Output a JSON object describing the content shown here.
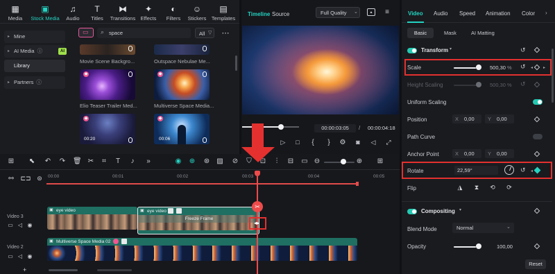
{
  "media_tabs": [
    {
      "label": "Media",
      "icon": "media-icon"
    },
    {
      "label": "Stock Media",
      "icon": "stock-media-icon"
    },
    {
      "label": "Audio",
      "icon": "audio-icon"
    },
    {
      "label": "Titles",
      "icon": "titles-icon"
    },
    {
      "label": "Transitions",
      "icon": "transitions-icon"
    },
    {
      "label": "Effects",
      "icon": "effects-icon"
    },
    {
      "label": "Filters",
      "icon": "filters-icon"
    },
    {
      "label": "Stickers",
      "icon": "stickers-icon"
    },
    {
      "label": "Templates",
      "icon": "templates-icon"
    }
  ],
  "sidebar": {
    "items": [
      {
        "label": "Mine"
      },
      {
        "label": "AI Media",
        "badge": "AI"
      },
      {
        "label": "Library"
      },
      {
        "label": "Partners"
      }
    ]
  },
  "search": {
    "value": "space",
    "filter": "All"
  },
  "thumbs": [
    {
      "label": "Movie Scene Backgro..."
    },
    {
      "label": "Outspace Nebulae Me..."
    },
    {
      "label": "Elio Teaser Trailer Med..."
    },
    {
      "label": "Multiverse Space Media..."
    },
    {
      "label": "",
      "duration": "00:20"
    },
    {
      "label": "",
      "duration": "00:06"
    }
  ],
  "player": {
    "tab_timeline": "Timeline",
    "tab_source": "Source",
    "quality": "Full Quality",
    "current_time": "00:00:03:05",
    "separator": "/",
    "total_time": "00:00:04:18",
    "progress": 0.65
  },
  "timeline": {
    "ruler": [
      "00:00",
      "00:01",
      "00:02",
      "00:03",
      "00:04",
      "00:05"
    ],
    "tracks": [
      {
        "label": "Video 3"
      },
      {
        "label": "Video 2"
      }
    ],
    "clips": {
      "eye1": "eye video",
      "eye2": "eye video",
      "freeze": "Freeze Frame",
      "space": "Multiverse Space Media 02"
    },
    "zoom": 0.5
  },
  "inspector": {
    "tabs": [
      "Video",
      "Audio",
      "Speed",
      "Animation",
      "Color"
    ],
    "subtabs": [
      "Basic",
      "Mask",
      "AI Matting"
    ],
    "transform_title": "Transform",
    "scale": {
      "label": "Scale",
      "value": "500,30",
      "unit": "%",
      "level": 0.8
    },
    "height_scaling": {
      "label": "Height Scaling",
      "value": "500,30",
      "unit": "%"
    },
    "uniform_scaling": "Uniform Scaling",
    "position": {
      "label": "Position",
      "x": "0,00",
      "y": "0,00",
      "x_axis": "X",
      "y_axis": "Y"
    },
    "path_curve": "Path Curve",
    "anchor_point": {
      "label": "Anchor Point",
      "x": "0,00",
      "y": "0,00",
      "x_axis": "X",
      "y_axis": "Y"
    },
    "rotate": {
      "label": "Rotate",
      "value": "22,59°"
    },
    "flip": "Flip",
    "compositing_title": "Compositing",
    "blend_mode": {
      "label": "Blend Mode",
      "value": "Normal"
    },
    "opacity": {
      "label": "Opacity",
      "value": "100,00",
      "level": 1.0
    },
    "reset": "Reset"
  },
  "colors": {
    "accent": "#24d3c2",
    "playhead": "#ee4b4b",
    "highlight": "#e4312f",
    "clip_green": "#1f6f62"
  }
}
